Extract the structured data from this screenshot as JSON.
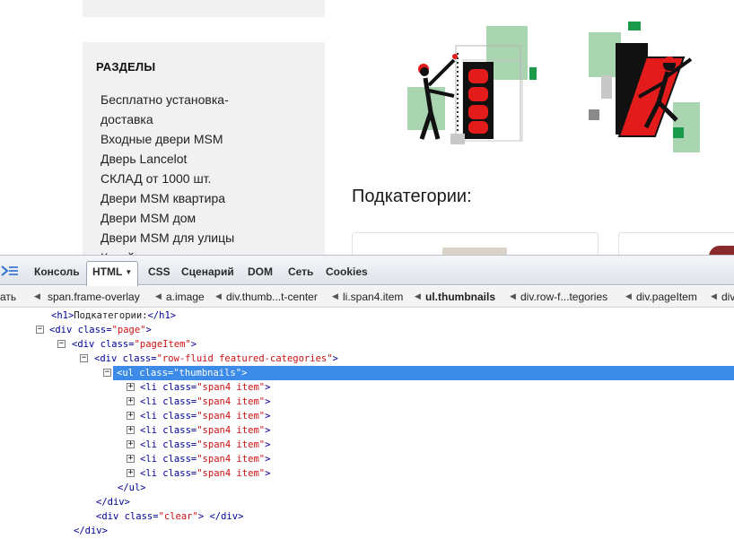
{
  "page": {
    "sections": {
      "title": "РАЗДЕЛЫ",
      "items": [
        "Бесплатно установка-доставка",
        "Входные двери MSM",
        "Дверь Lancelot",
        "СКЛАД от 1000 шт.",
        "Двери MSM квартира",
        "Двери MSM дом",
        "Двери MSM для улицы",
        "Китайские двери"
      ]
    },
    "subcategories_title": "Подкатегории:",
    "colors": {
      "brand_red": "#e31b1b",
      "brand_green": "#1a9a4a",
      "light_green": "#a8d5b0"
    }
  },
  "devtools": {
    "tabs": [
      "Консоль",
      "HTML",
      "CSS",
      "Сценарий",
      "DOM",
      "Сеть",
      "Cookies"
    ],
    "active_tab": "HTML",
    "breadcrumbs": [
      "ать",
      "span.frame-overlay",
      "a.image",
      "div.thumb...t-center",
      "li.span4.item",
      "ul.thumbnails",
      "div.row-f...tegories",
      "div.pageItem",
      "div"
    ],
    "selected_crumb": "ul.thumbnails",
    "tree": {
      "h1_open": "<h1>",
      "h1_text": "Подкатегории:",
      "h1_close": "</h1>",
      "div_page": {
        "tag": "<div",
        "attr": " class=",
        "val": "\"page\"",
        "end": ">"
      },
      "div_pageitem": {
        "tag": "<div",
        "attr": " class=",
        "val": "\"pageItem\"",
        "end": ">"
      },
      "div_row": {
        "tag": "<div",
        "attr": " class=",
        "val": "\"row-fluid featured-categories\"",
        "end": ">"
      },
      "ul_thumbnails": "<ul class=\"thumbnails\">",
      "li_item": {
        "tag": "<li",
        "attr": " class=",
        "val": "\"span4 item\"",
        "end": ">"
      },
      "ul_close": "</ul>",
      "div_close": "</div>",
      "div_clear": {
        "tag": "<div",
        "attr": " class=",
        "val": "\"clear\"",
        "end": "> </div>"
      }
    }
  }
}
